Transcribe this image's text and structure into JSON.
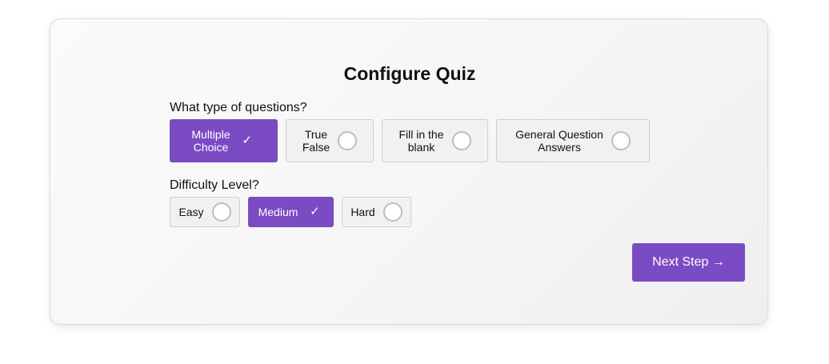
{
  "quiz": {
    "title": "Configure Quiz",
    "question_type": {
      "label": "What type of questions?",
      "options": [
        {
          "line1": "Multiple",
          "line2": "Choice",
          "selected": true,
          "indicator": "✓"
        },
        {
          "line1": "True",
          "line2": "False",
          "selected": false
        },
        {
          "line1": "Fill in the",
          "line2": "blank",
          "selected": false
        },
        {
          "line1": "General Question",
          "line2": "Answers",
          "selected": false
        }
      ]
    },
    "difficulty": {
      "label": "Difficulty Level?",
      "options": [
        {
          "label": "Easy",
          "selected": false
        },
        {
          "label": "Medium",
          "selected": true,
          "indicator": "✓"
        },
        {
          "label": "Hard",
          "selected": false
        }
      ]
    },
    "next_button": "Next Step →"
  },
  "colors": {
    "accent": "#7b4bc4",
    "option_bg": "#f1f1f1",
    "option_border": "#cfcfcf"
  },
  "icons": {
    "selected": "check-icon",
    "unselected": "radio-circle-icon"
  }
}
